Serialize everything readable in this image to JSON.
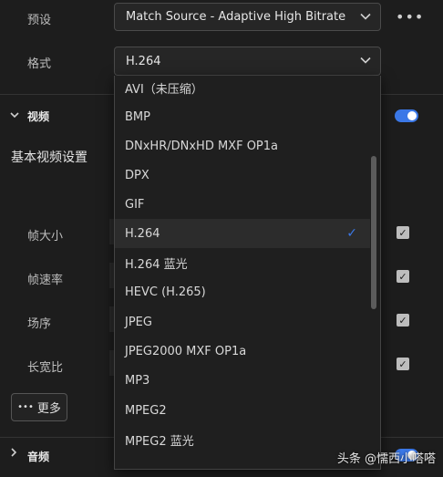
{
  "preset": {
    "label": "预设",
    "value": "Match Source - Adaptive High Bitrate",
    "more": "•••"
  },
  "format": {
    "label": "格式",
    "value": "H.264"
  },
  "video_section": {
    "title": "视频",
    "basic_settings": "基本视频设置",
    "rows": [
      {
        "label": "帧大小"
      },
      {
        "label": "帧速率"
      },
      {
        "label": "场序"
      },
      {
        "label": "长宽比"
      }
    ],
    "more_button": "更多",
    "more_dots": "•••"
  },
  "audio_section": {
    "title": "音频"
  },
  "dropdown": {
    "items": [
      "AVI（未压缩）",
      "BMP",
      "DNxHR/DNxHD MXF OP1a",
      "DPX",
      "GIF",
      "H.264",
      "H.264 蓝光",
      "HEVC (H.265)",
      "JPEG",
      "JPEG2000 MXF OP1a",
      "MP3",
      "MPEG2",
      "MPEG2 蓝光"
    ],
    "selected_index": 5
  },
  "watermark": "头条 @懦西小嗒嗒",
  "colors": {
    "accent": "#3b78e7",
    "background": "#1d1d1d"
  }
}
